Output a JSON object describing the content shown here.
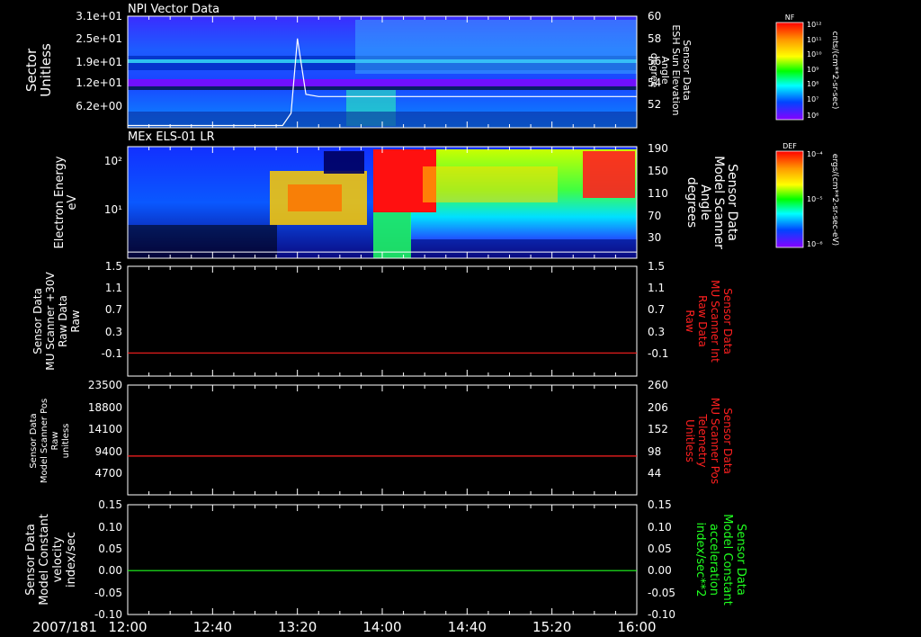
{
  "chart_data": {
    "type": "line",
    "date_label": "2007/181",
    "x_ticks": [
      "12:00",
      "12:40",
      "13:20",
      "14:00",
      "14:40",
      "15:20",
      "16:00"
    ],
    "panels": [
      {
        "id": "npi",
        "kind": "spectrogram",
        "title": "NPI Vector Data",
        "ylabel": [
          "Sector",
          "Unitless"
        ],
        "yticks_left": [
          "3.1e+01",
          "2.5e+01",
          "1.9e+01",
          "1.2e+01",
          "6.2e+00"
        ],
        "ylabel_right": [
          "Sensor Data",
          "ESH Sun Elevation",
          "Angle",
          "degree"
        ],
        "yticks_right": [
          "60",
          "58",
          "56",
          "54",
          "52"
        ],
        "yrange_right": [
          50,
          60
        ],
        "overlay": {
          "series": "ESH Sun Elevation Angle",
          "x": [
            "12:00",
            "13:13",
            "13:17",
            "13:20",
            "13:24",
            "13:30",
            "16:00"
          ],
          "y": [
            50.2,
            50.2,
            51.3,
            58.0,
            53.0,
            52.8,
            52.8
          ]
        },
        "colorbar": {
          "label": "NF",
          "units": "cnts/(cm**2-sr-sec)",
          "ticks": [
            "10¹²",
            "10¹¹",
            "10¹⁰",
            "10⁹",
            "10⁸",
            "10⁷",
            "10⁶"
          ]
        }
      },
      {
        "id": "els",
        "kind": "spectrogram",
        "title": "MEx ELS-01 LR",
        "ylabel": [
          "Electron Energy",
          "eV"
        ],
        "yticks_left": [
          "10²",
          "10¹"
        ],
        "ylabel_right": [
          "Sensor Data",
          "Model Scanner",
          "Angle",
          "degrees"
        ],
        "yticks_right": [
          "190",
          "150",
          "110",
          "70",
          "30"
        ],
        "yrange_right": [
          10,
          190
        ],
        "overlay": {
          "series": "Model Scanner Angle",
          "x": [
            "12:00",
            "16:00"
          ],
          "y": [
            20,
            20
          ]
        },
        "colorbar": {
          "label": "DEF",
          "units": "ergs/(cm**2-sr-sec-eV)",
          "ticks": [
            "10⁻⁴",
            "10⁻⁵",
            "10⁻⁶"
          ]
        }
      },
      {
        "id": "mu30",
        "kind": "line",
        "ylabel": [
          "Sensor Data",
          "MU Scanner +30V",
          "Raw Data",
          "Raw"
        ],
        "yticks_left": [
          "1.5",
          "1.1",
          "0.7",
          "0.3",
          "-0.1"
        ],
        "ylabel_right": [
          "Sensor Data",
          "MU Scanner Int",
          "Raw Data",
          "Raw"
        ],
        "yticks_right": [
          "1.5",
          "1.1",
          "0.7",
          "0.3",
          "-0.1"
        ],
        "yrange": [
          -0.4,
          1.5
        ],
        "right_color": "#ff2020",
        "series": [
          {
            "color": "#ff2020",
            "x": [
              "12:00",
              "16:00"
            ],
            "y": [
              0.0,
              0.0
            ]
          }
        ]
      },
      {
        "id": "pos",
        "kind": "line",
        "ylabel": [
          "Sensor Data",
          "Model Scanner Pos",
          "Raw",
          "unitless"
        ],
        "yticks_left": [
          "23500",
          "18800",
          "14100",
          "9400",
          "4700"
        ],
        "ylabel_right": [
          "Sensor Data",
          "MU Scanner Pos",
          "Telemetry",
          "Unitless"
        ],
        "yticks_right": [
          "260",
          "206",
          "152",
          "98",
          "44"
        ],
        "yrange": [
          0,
          23500
        ],
        "right_color": "#ff2020",
        "series": [
          {
            "color": "#ff2020",
            "x": [
              "12:00",
              "16:00"
            ],
            "y": [
              8300,
              8300
            ]
          }
        ]
      },
      {
        "id": "vel",
        "kind": "line",
        "ylabel": [
          "Sensor Data",
          "Model Constant",
          "velocity",
          "index/sec"
        ],
        "yticks_left": [
          "0.15",
          "0.10",
          "0.05",
          "0.00",
          "-0.05",
          "-0.10"
        ],
        "ylabel_right": [
          "Sensor Data",
          "Model Constant",
          "acceleration",
          "index/sec**2"
        ],
        "yticks_right": [
          "0.15",
          "0.10",
          "0.05",
          "0.00",
          "-0.05",
          "-0.10"
        ],
        "yrange": [
          -0.1,
          0.15
        ],
        "right_color": "#20ff20",
        "series": [
          {
            "color": "#20ff20",
            "x": [
              "12:00",
              "16:00"
            ],
            "y": [
              0.0,
              0.0
            ]
          }
        ]
      }
    ]
  }
}
